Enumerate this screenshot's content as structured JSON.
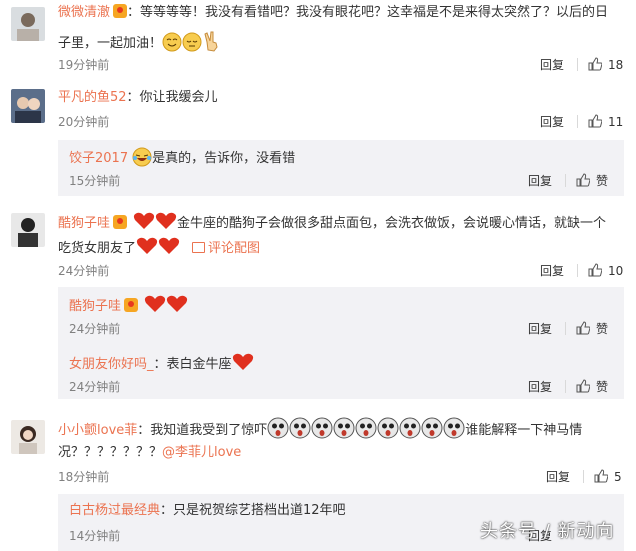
{
  "labels": {
    "reply": "回复",
    "like": "赞",
    "view_pic": "评论配图"
  },
  "comments": [
    {
      "user": "微微清澈",
      "text1": "：等等等等！我没有看错吧？我没有眼花吧？这幸福是不是来得太突然了？以后的日",
      "text2": "子里，一起加油！",
      "time": "19分钟前",
      "likes": "18"
    },
    {
      "user": "平凡的鱼52",
      "text": "：你让我缓会儿",
      "time": "20分钟前",
      "likes": "11",
      "reply": {
        "user": "饺子2017",
        "text": "是真的，告诉你，没看错",
        "time": "15分钟前"
      }
    },
    {
      "user": "酷狗子哇",
      "text1": "金牛座的酷狗子会做很多甜点面包，会洗衣做饭，会说暖心情话，就缺一个",
      "text2": "吃货女朋友了",
      "time": "24分钟前",
      "likes": "10",
      "replies": [
        {
          "user": "酷狗子哇",
          "text": "",
          "time": "24分钟前"
        },
        {
          "user": "女朋友你好吗_",
          "text": "：表白金牛座",
          "time": "24分钟前"
        }
      ]
    },
    {
      "user": "小小颤love菲",
      "text1": "：我知道我受到了惊吓",
      "text1b": "谁能解释一下神马情",
      "text2": "况？？？？？？？",
      "mention": "@李菲儿love",
      "time": "18分钟前",
      "likes": "5",
      "reply": {
        "user": "白古杨过最经典",
        "text": "：只是祝贺综艺搭档出道12年吧",
        "time": "14分钟前"
      }
    }
  ],
  "watermark": "头条号 / 新动向",
  "colors": {
    "username": "#eb7350",
    "meta": "#808080",
    "subbox": "#f2f2f5"
  }
}
